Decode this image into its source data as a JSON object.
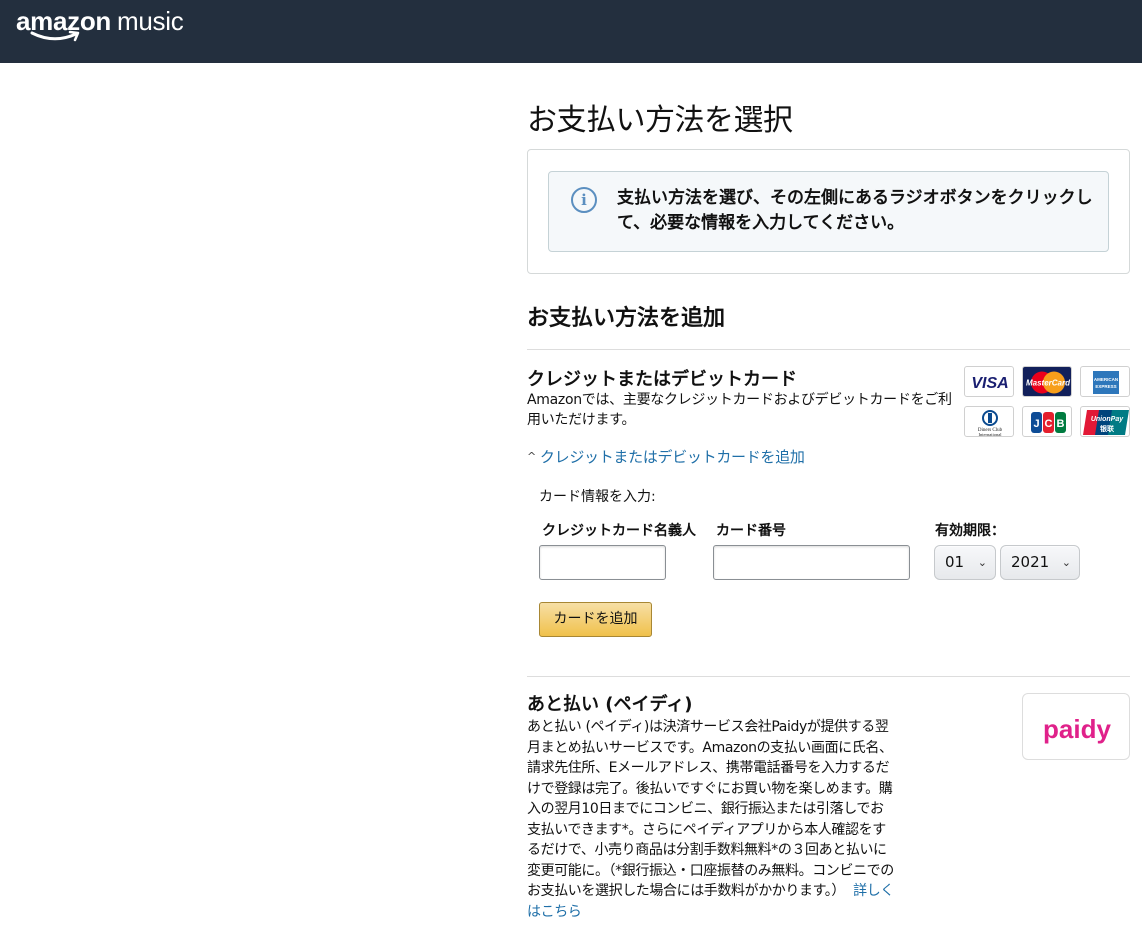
{
  "header": {
    "logo_brand": "amazon",
    "logo_product": "music",
    "background": "#232f3e"
  },
  "page": {
    "title": "お支払い方法を選択"
  },
  "info": {
    "icon": "info-icon",
    "icon_glyph": "i",
    "message": "支払い方法を選び、その左側にあるラジオボタンをクリックして、必要な情報を入力してください。"
  },
  "add_section": {
    "title": "お支払い方法を追加"
  },
  "card": {
    "title": "クレジットまたはデビットカード",
    "description": "Amazonでは、主要なクレジットカードおよびデビットカードをご利用いただけます。",
    "logos": [
      "VISA",
      "MasterCard",
      "AMEX",
      "Diners Club International",
      "JCB",
      "UnionPay"
    ],
    "logo_texts": {
      "visa": "VISA",
      "mastercard": "MasterCard",
      "amex": "AMERICAN EXPRESS",
      "diners": "Diners Club International",
      "jcb": "JCB",
      "unionpay_en": "UnionPay",
      "unionpay_cn": "银联"
    },
    "expand_link": "クレジットまたはデビットカードを追加",
    "form_caption": "カード情報を入力:",
    "name_label": "クレジットカード名義人",
    "number_label": "カード番号",
    "expiry_label": "有効期限：",
    "expiry_month": "01",
    "expiry_year": "2021",
    "add_button": "カードを追加",
    "accent": "#f0c14b"
  },
  "paidy": {
    "title": "あと払い (ペイディ)",
    "description": "あと払い (ペイディ)は決済サービス会社Paidyが提供する翌月まとめ払いサービスです。Amazonの支払い画面に氏名、請求先住所、Eメールアドレス、携帯電話番号を入力するだけで登録は完了。後払いですぐにお買い物を楽しめます。購入の翌月10日までにコンビニ、銀行振込または引落しでお支払いできます*。さらにペイディアプリから本人確認をするだけで、小売り商品は分割手数料無料*の３回あと払いに変更可能に。（*銀行振込・口座振替のみ無料。コンビニでのお支払いを選択した場合には手数料がかかります。）",
    "more_link": "詳しくはこちら",
    "logo_text": "paidy",
    "logo_color": "#e0218a",
    "link_color": "#1f6fa8"
  }
}
